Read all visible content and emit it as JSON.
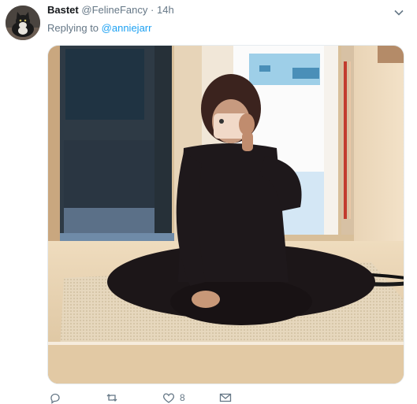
{
  "tweet": {
    "author_name": "Bastet",
    "author_handle": "@FelineFancy",
    "separator": "·",
    "time": "14h",
    "replying_prefix": "Replying to",
    "replying_to": "@anniejarr",
    "likes": "8"
  },
  "icons": {
    "caret": "chevron-down-icon",
    "reply": "reply-icon",
    "retweet": "retweet-icon",
    "like": "heart-icon",
    "message": "envelope-icon"
  },
  "colors": {
    "name": "#14171a",
    "secondary": "#657786",
    "link": "#1da1f2",
    "divider": "#e6ecf0"
  }
}
